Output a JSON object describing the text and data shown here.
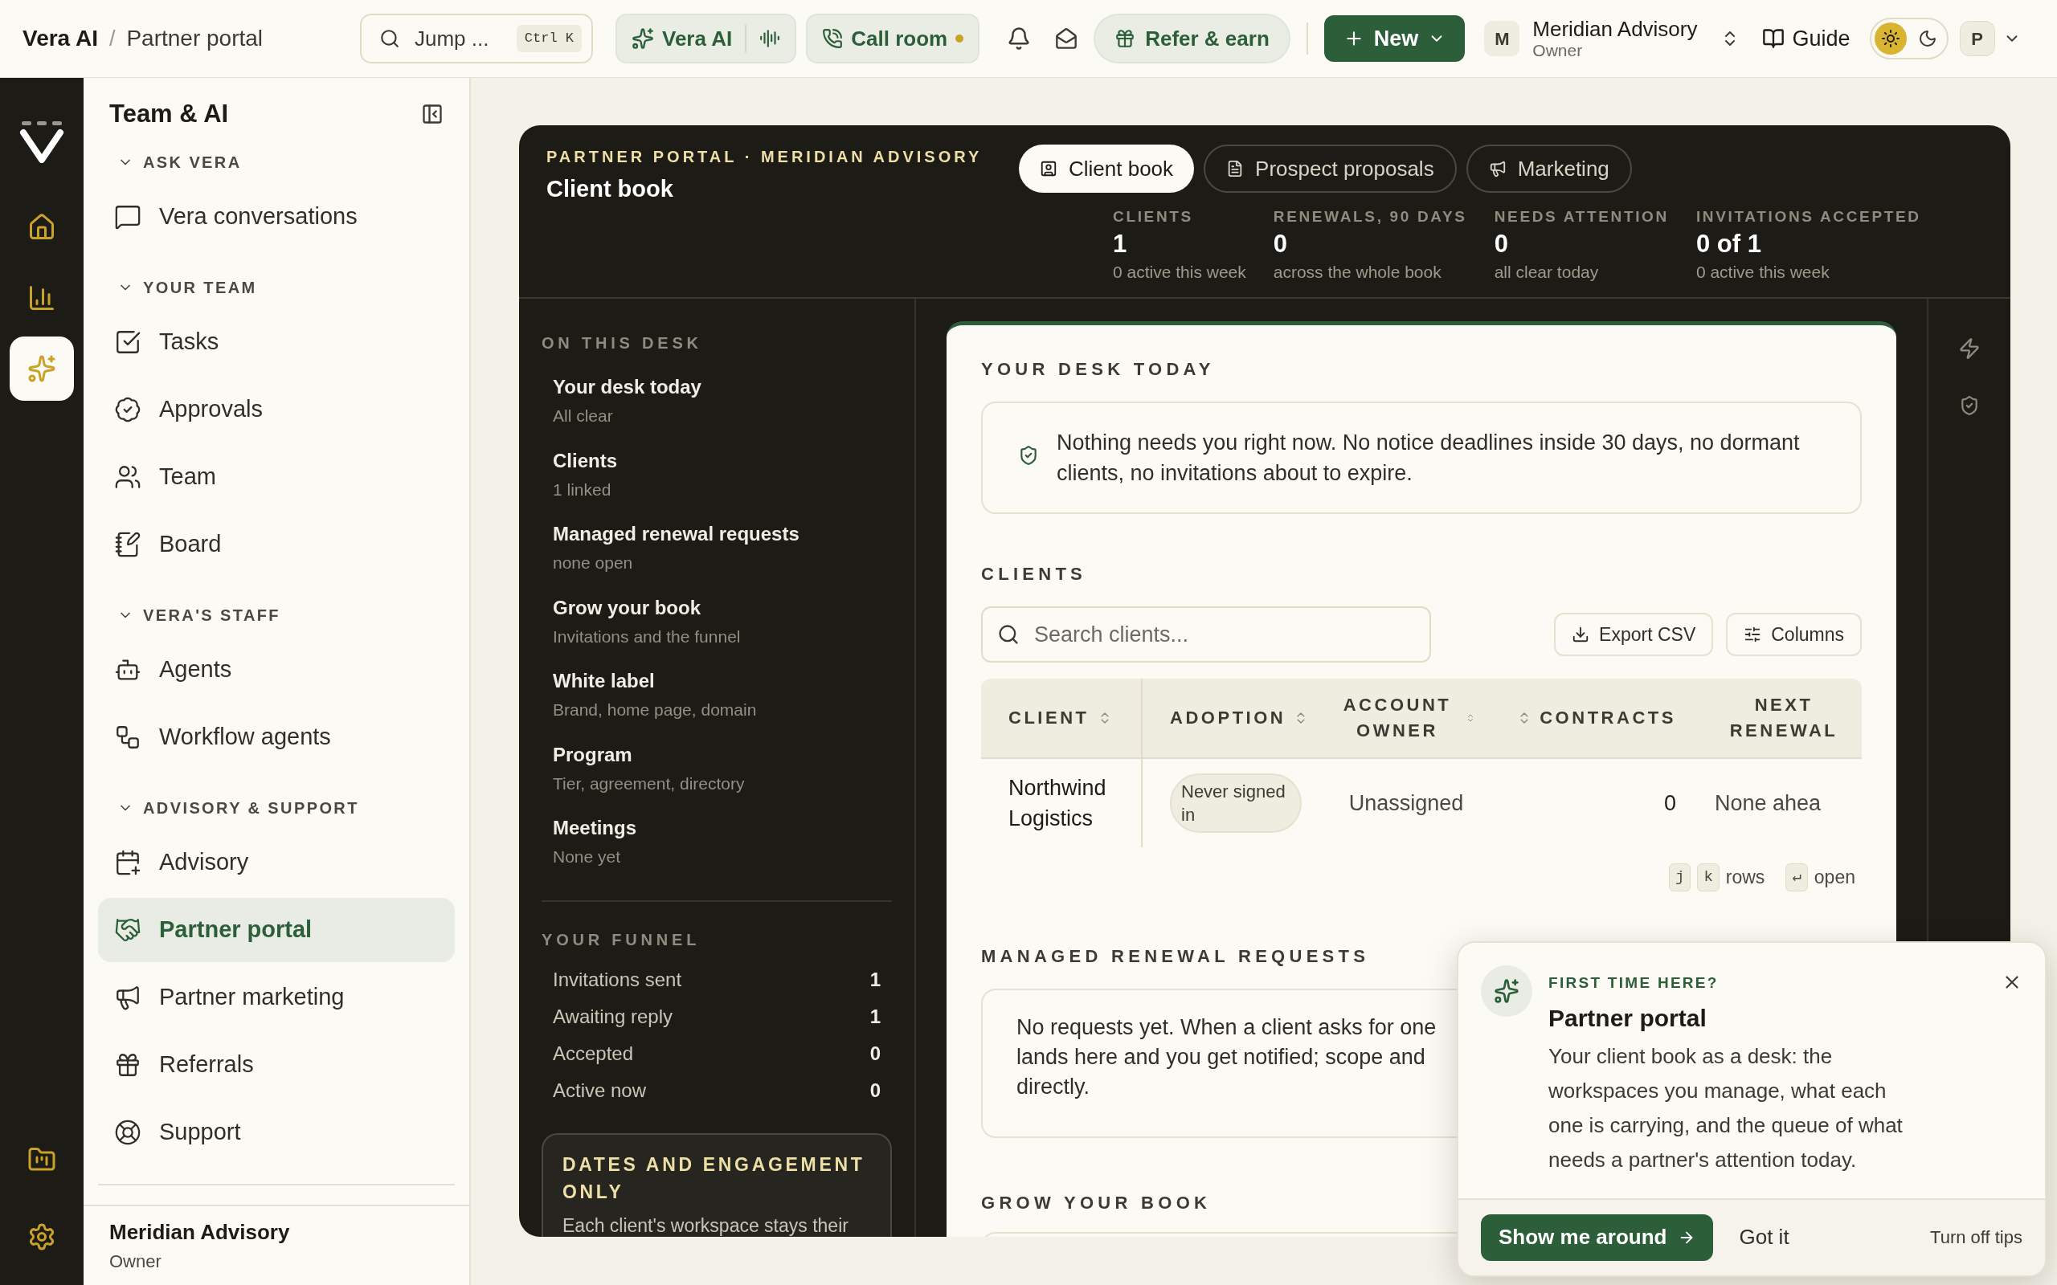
{
  "breadcrumb": {
    "items": [
      "Vera AI",
      "Partner portal"
    ],
    "separator": "/"
  },
  "topbar": {
    "search": {
      "placeholder": "Jump ...",
      "shortcut": "Ctrl K"
    },
    "assistant_button": "Vera AI",
    "call_button": {
      "label": "Call room",
      "live": true
    },
    "refer_button": "Refer & earn",
    "new_button": "New",
    "account": {
      "initial": "M",
      "name": "Meridian Advisory",
      "role": "Owner"
    },
    "guide_button": "Guide",
    "theme_toggle": [
      {
        "kind": "sun",
        "selected": true
      },
      {
        "kind": "moon",
        "selected": false
      }
    ],
    "user_initial": "P"
  },
  "rail_top": [
    {
      "selected": false
    },
    {
      "selected": false
    },
    {
      "selected": true
    }
  ],
  "rail_bottom": [
    {
      "selected": false
    },
    {
      "selected": false
    }
  ],
  "sidebar": {
    "title": "Team & AI",
    "sections": [
      {
        "label": "ASK VERA",
        "expanded": true,
        "items": [
          {
            "label": "Vera conversations",
            "selected": false
          }
        ]
      },
      {
        "label": "YOUR TEAM",
        "expanded": true,
        "items": [
          {
            "label": "Tasks",
            "selected": false
          },
          {
            "label": "Approvals",
            "selected": false
          },
          {
            "label": "Team",
            "selected": false
          },
          {
            "label": "Board",
            "selected": false
          }
        ]
      },
      {
        "label": "VERA'S STAFF",
        "expanded": true,
        "items": [
          {
            "label": "Agents",
            "selected": false
          },
          {
            "label": "Workflow agents",
            "selected": false
          }
        ]
      },
      {
        "label": "ADVISORY & SUPPORT",
        "expanded": true,
        "items": [
          {
            "label": "Advisory",
            "selected": false
          },
          {
            "label": "Partner portal",
            "selected": true
          },
          {
            "label": "Partner marketing",
            "selected": false
          },
          {
            "label": "Referrals",
            "selected": false
          },
          {
            "label": "Support",
            "selected": false
          }
        ]
      }
    ],
    "footer": {
      "name": "Meridian Advisory",
      "role": "Owner"
    }
  },
  "panel": {
    "eyebrow": "PARTNER PORTAL · MERIDIAN ADVISORY",
    "title": "Client book",
    "tabs": [
      {
        "label": "Client book",
        "selected": true
      },
      {
        "label": "Prospect proposals",
        "selected": false
      },
      {
        "label": "Marketing",
        "selected": false
      }
    ],
    "stats": [
      {
        "label": "CLIENTS",
        "value": "1",
        "sub": "0 active this week"
      },
      {
        "label": "RENEWALS, 90 DAYS",
        "value": "0",
        "sub": "across the whole book"
      },
      {
        "label": "NEEDS ATTENTION",
        "value": "0",
        "sub": "all clear today"
      },
      {
        "label": "INVITATIONS ACCEPTED",
        "value": "0 of 1",
        "sub": "0 active this week"
      }
    ],
    "desk_nav": {
      "heading": "ON THIS DESK",
      "items": [
        {
          "title": "Your desk today",
          "sub": "All clear"
        },
        {
          "title": "Clients",
          "sub": "1 linked"
        },
        {
          "title": "Managed renewal requests",
          "sub": "none open"
        },
        {
          "title": "Grow your book",
          "sub": "Invitations and the funnel"
        },
        {
          "title": "White label",
          "sub": "Brand, home page, domain"
        },
        {
          "title": "Program",
          "sub": "Tier, agreement, directory"
        },
        {
          "title": "Meetings",
          "sub": "None yet"
        }
      ]
    },
    "funnel": {
      "heading": "YOUR FUNNEL",
      "rows": [
        {
          "label": "Invitations sent",
          "value": "1"
        },
        {
          "label": "Awaiting reply",
          "value": "1"
        },
        {
          "label": "Accepted",
          "value": "0"
        },
        {
          "label": "Active now",
          "value": "0"
        }
      ]
    },
    "notice": {
      "title": "DATES AND ENGAGEMENT ONLY",
      "text": "Each client's workspace stays their"
    }
  },
  "desk": {
    "heading": "YOUR DESK TODAY",
    "message": "Nothing needs you right now. No notice deadlines inside 30 days, no dormant clients, no invitations about to expire."
  },
  "clients": {
    "heading": "CLIENTS",
    "search": {
      "placeholder": "Search clients..."
    },
    "buttons": [
      "Export CSV",
      "Columns"
    ],
    "columns": [
      {
        "label": "CLIENT",
        "sortable": true
      },
      {
        "label": "ADOPTION",
        "sortable": true
      },
      {
        "label": "ACCOUNT OWNER",
        "sortable": true
      },
      {
        "label": "CONTRACTS",
        "sortable": true
      },
      {
        "label": "NEXT RENEWAL",
        "sortable": false
      }
    ],
    "rows": [
      {
        "client": "Northwind Logistics",
        "adoption": "Never signed in",
        "owner": "Unassigned",
        "contracts": "0",
        "next_renewal": "None ahea"
      }
    ],
    "hints": [
      {
        "keys": [
          "j",
          "k"
        ],
        "label": "rows"
      },
      {
        "keys": [
          "↵"
        ],
        "label": "open"
      }
    ]
  },
  "renewals": {
    "heading": "MANAGED RENEWAL REQUESTS",
    "lines": [
      "No requests yet. When a client asks for one",
      "lands here and you get notified; scope and",
      "directly."
    ]
  },
  "grow": {
    "heading": "GROW YOUR BOOK"
  },
  "tip": {
    "eyebrow": "FIRST TIME HERE?",
    "title": "Partner portal",
    "body": "Your client book as a desk: the workspaces you manage, what each one is carrying, and the queue of what needs a partner's attention today.",
    "primary": "Show me around",
    "secondary": "Got it",
    "tertiary": "Turn off tips"
  }
}
